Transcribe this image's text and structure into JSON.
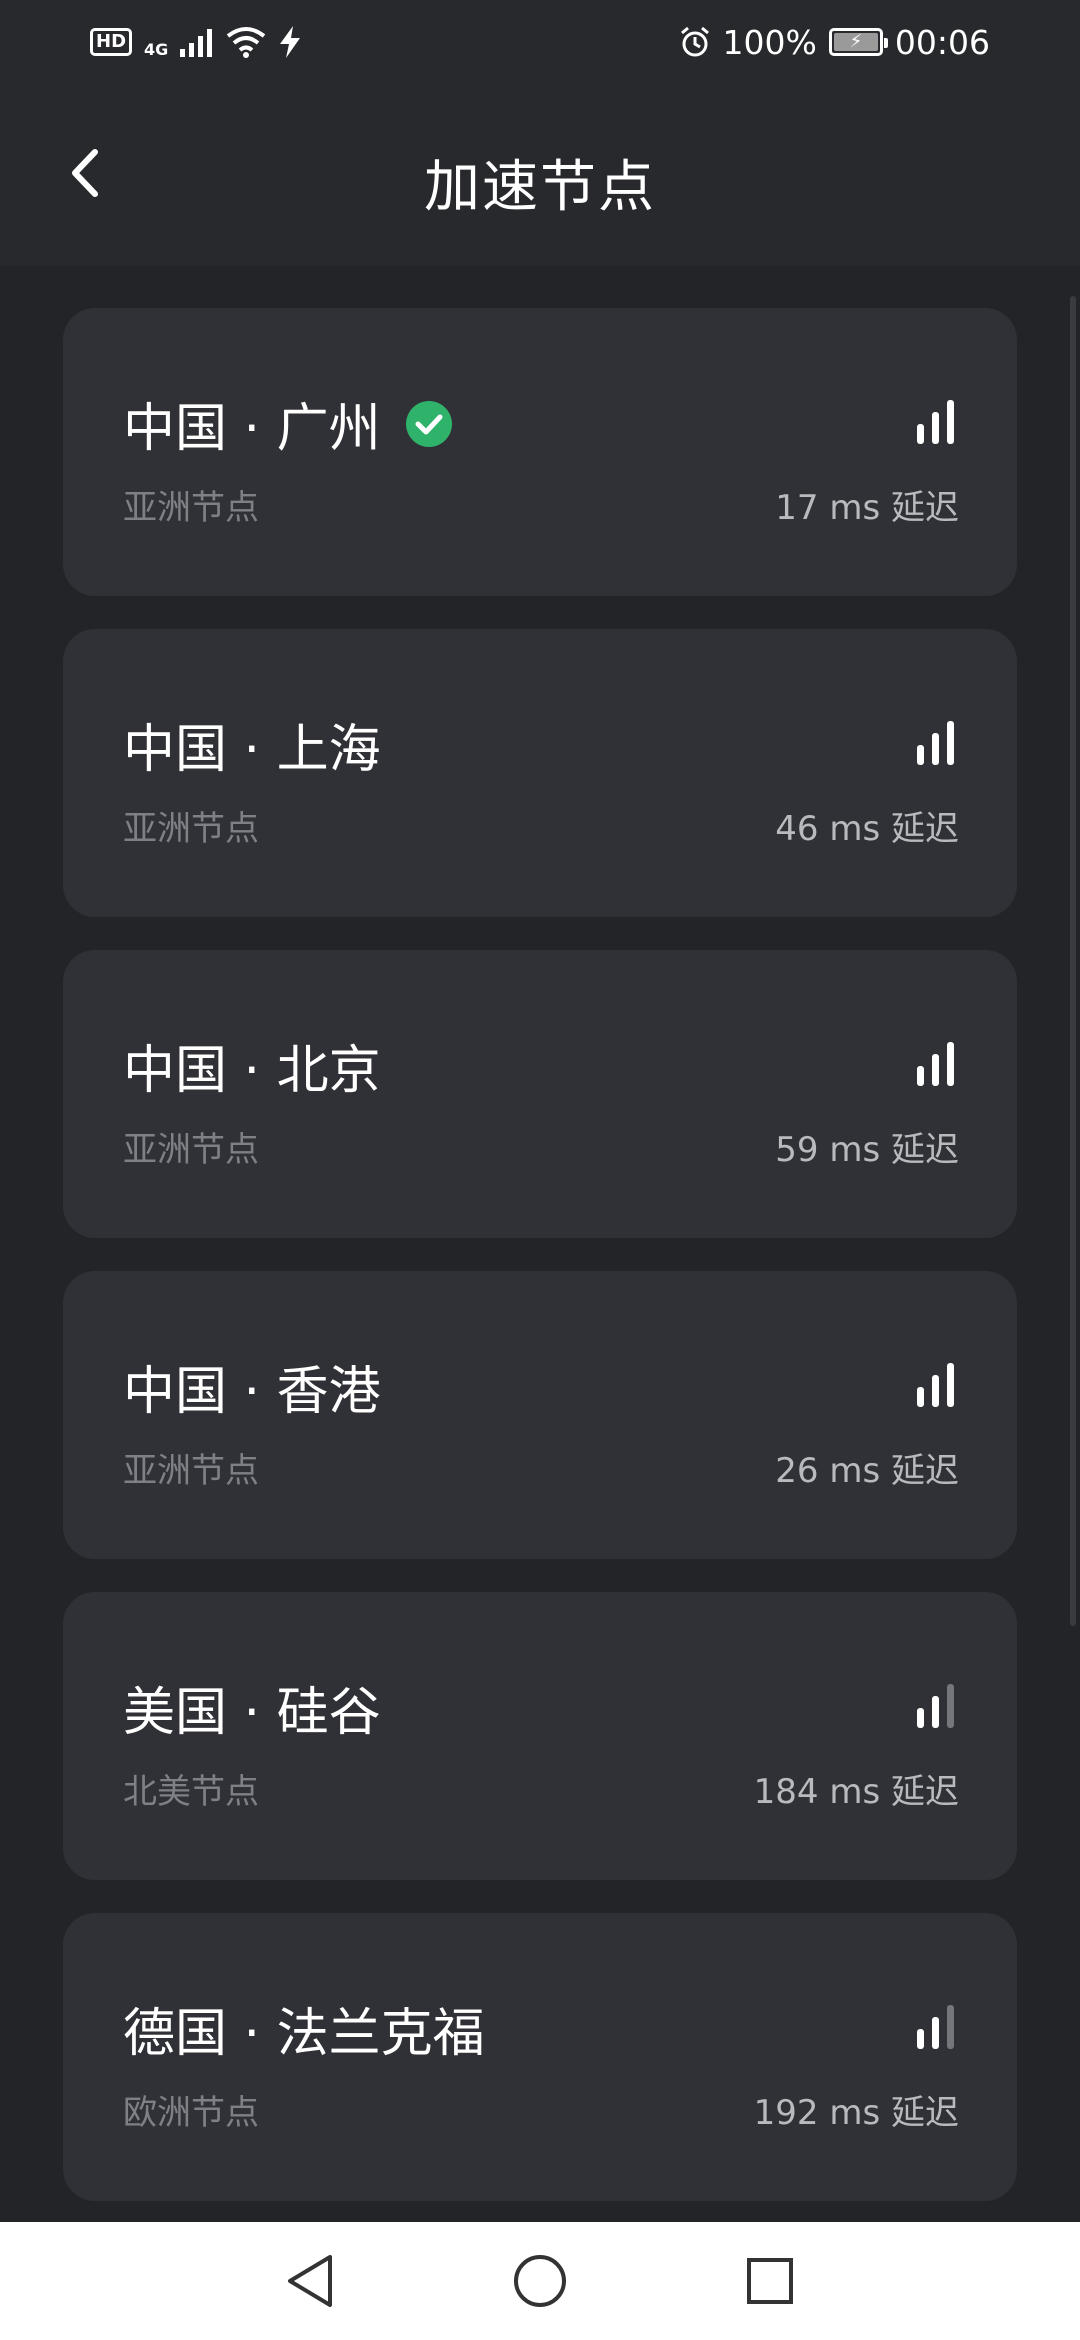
{
  "status_bar": {
    "hd": "HD",
    "network": "4G",
    "battery": "100%",
    "time": "00:06",
    "icons": [
      "signal-icon",
      "wifi-icon",
      "charging-icon",
      "alarm-icon",
      "battery-icon"
    ]
  },
  "header": {
    "title": "加速节点",
    "back_icon": "chevron-left-icon"
  },
  "nodes": [
    {
      "name": "中国 · 广州",
      "region": "亚洲节点",
      "latency": "17 ms 延迟",
      "selected": true,
      "signal_bars": 3
    },
    {
      "name": "中国 · 上海",
      "region": "亚洲节点",
      "latency": "46 ms 延迟",
      "selected": false,
      "signal_bars": 3
    },
    {
      "name": "中国 · 北京",
      "region": "亚洲节点",
      "latency": "59 ms 延迟",
      "selected": false,
      "signal_bars": 3
    },
    {
      "name": "中国 · 香港",
      "region": "亚洲节点",
      "latency": "26 ms 延迟",
      "selected": false,
      "signal_bars": 3
    },
    {
      "name": "美国 · 硅谷",
      "region": "北美节点",
      "latency": "184 ms 延迟",
      "selected": false,
      "signal_bars": 2
    },
    {
      "name": "德国 · 法兰克福",
      "region": "欧洲节点",
      "latency": "192 ms 延迟",
      "selected": false,
      "signal_bars": 2
    }
  ],
  "colors": {
    "background": "#232428",
    "card": "#303136",
    "accent_check": "#2fb36a",
    "secondary_text": "#7f8086"
  },
  "nav_bar": {
    "icons": [
      "back-triangle-icon",
      "home-circle-icon",
      "recents-square-icon"
    ]
  }
}
